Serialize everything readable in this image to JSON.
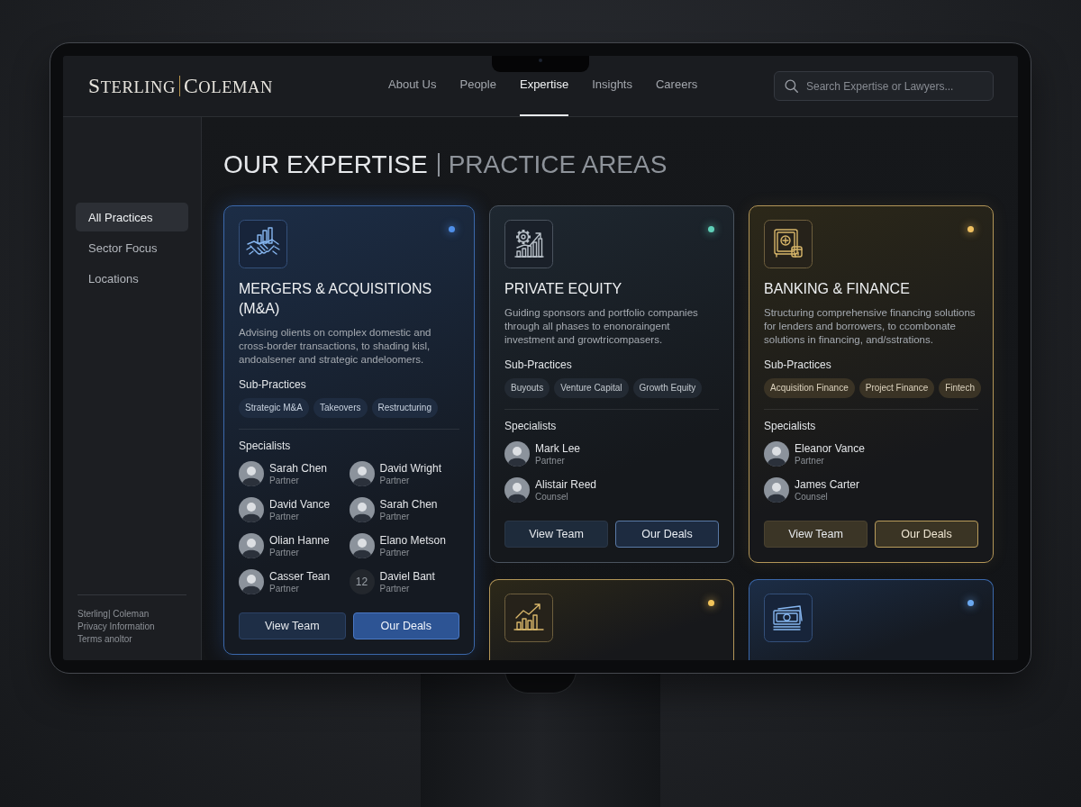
{
  "logo": {
    "first": "STERLING",
    "second": "COLEMAN"
  },
  "nav": [
    {
      "label": "About Us",
      "selected": false
    },
    {
      "label": "People",
      "selected": false
    },
    {
      "label": "Expertise",
      "selected": true
    },
    {
      "label": "Insights",
      "selected": false
    },
    {
      "label": "Careers",
      "selected": false
    }
  ],
  "search": {
    "placeholder": "Search Expertise or Lawyers..."
  },
  "sidebar": {
    "items": [
      {
        "label": "All Practices",
        "selected": true
      },
      {
        "label": "Sector Focus",
        "selected": false
      },
      {
        "label": "Locations",
        "selected": false
      }
    ],
    "footer_links": [
      "Sterling| Coleman",
      "Privacy Information",
      "Terms anoltor"
    ]
  },
  "heading": {
    "title": "OUR EXPERTISE",
    "subtitle": "PRACTICE AREAS"
  },
  "cards": [
    {
      "kind": "blue",
      "color": "#4f8fe8",
      "title": "MERGERS & ACQUISITIONS (M&A)",
      "description": "Advising olients on complex domestic and cross-border transactions, to shading kisl, andoalsener and strategic andeloomers.",
      "sub_practices_label": "Sub-Practices",
      "sub_practices": [
        "Strategic M&A",
        "Takeovers",
        "Restructuring"
      ],
      "specialists_label": "Specialists",
      "specialists": [
        {
          "kind": "photo",
          "name": "Sarah Chen",
          "role": "Partner"
        },
        {
          "kind": "photo",
          "name": "David Wright",
          "role": "Partner"
        },
        {
          "kind": "photo",
          "name": "David Vance",
          "role": "Partner"
        },
        {
          "kind": "photo",
          "name": "Sarah Chen",
          "role": "Partner"
        },
        {
          "kind": "photo",
          "name": "Olian Hanne",
          "role": "Partner"
        },
        {
          "kind": "photo",
          "name": "Elano Metson",
          "role": "Partner"
        },
        {
          "kind": "photo",
          "name": "Casser Tean",
          "role": "Partner"
        },
        {
          "kind": "count",
          "count": "12",
          "name": "Daviel Bant",
          "role": "Partner"
        }
      ],
      "buttons": [
        "View Team",
        "Our Deals"
      ]
    },
    {
      "kind": "slate",
      "color": "#5fd0b8",
      "title": "PRIVATE EQUITY",
      "description": "Guiding sponsors and portfolio companies through all phases to enonoraingent investment and growtricompasers.",
      "sub_practices_label": "Sub-Practices",
      "sub_practices": [
        "Buyouts",
        "Venture Capital",
        "Growth Equity"
      ],
      "specialists_label": "Specialists",
      "specialists": [
        {
          "kind": "photo",
          "name": "Mark Lee",
          "role": "Partner"
        },
        {
          "kind": "photo",
          "name": "Alistair Reed",
          "role": "Counsel"
        }
      ],
      "buttons": [
        "View Team",
        "Our Deals"
      ]
    },
    {
      "kind": "gold",
      "color": "#f0c060",
      "title": "BANKING & FINANCE",
      "description": "Structuring comprehensive financing solutions for lenders and borrowers, to ccombonate solutions in financing, and/sstrations.",
      "sub_practices_label": "Sub-Practices",
      "sub_practices": [
        "Acquisition Finance",
        "Project Finance",
        "Fintech"
      ],
      "specialists_label": "Specialists",
      "specialists": [
        {
          "kind": "photo",
          "name": "Eleanor Vance",
          "role": "Partner"
        },
        {
          "kind": "photo",
          "name": "James Carter",
          "role": "Counsel"
        }
      ],
      "buttons": [
        "View Team",
        "Our Deals"
      ]
    },
    {
      "kind": "gold",
      "color": "#f2c45a"
    },
    {
      "kind": "blue",
      "color": "#6aa8f0"
    }
  ]
}
